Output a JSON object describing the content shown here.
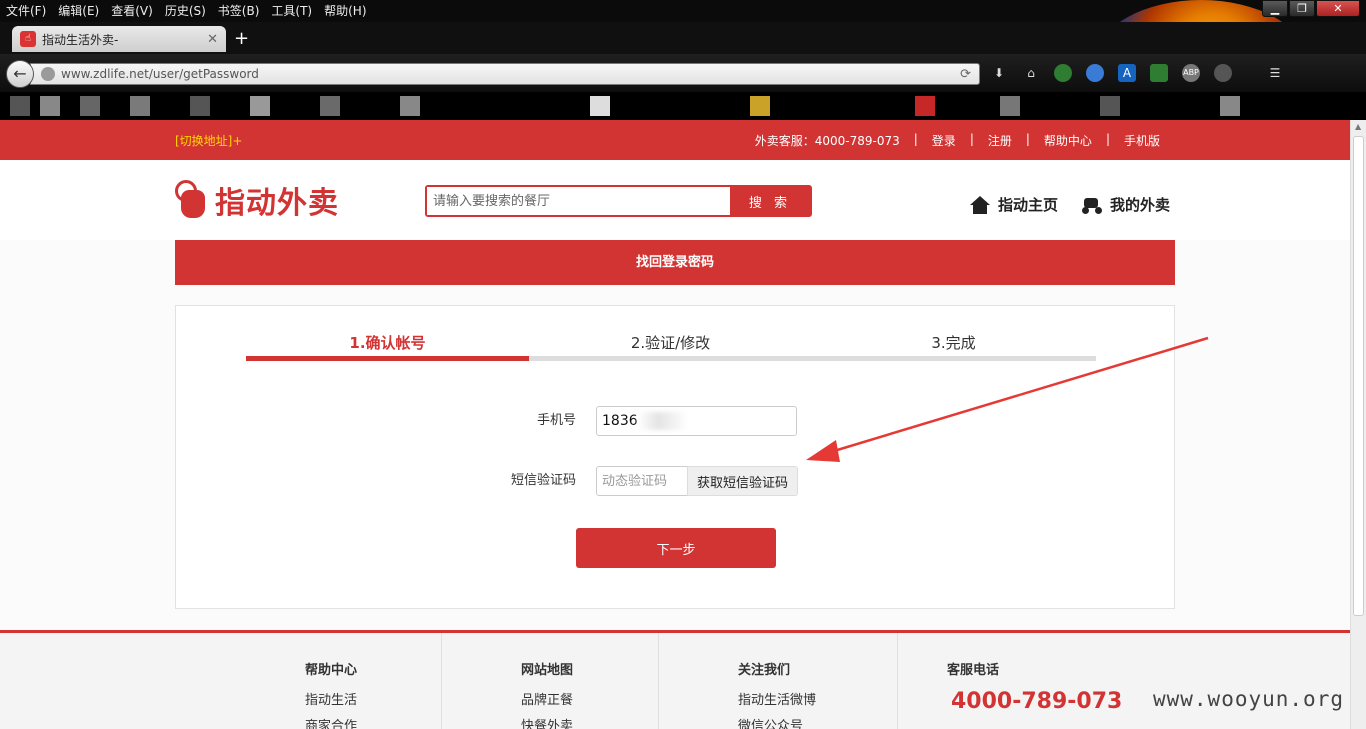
{
  "browser": {
    "menu": [
      "文件(F)",
      "编辑(E)",
      "查看(V)",
      "历史(S)",
      "书签(B)",
      "工具(T)",
      "帮助(H)"
    ],
    "tab_title": "指动生活外卖-",
    "url": "www.zdlife.net/user/getPassword"
  },
  "topbar": {
    "switch_address": "[切换地址]+",
    "hotline_label": "外卖客服：4000-789-073",
    "links": [
      "登录",
      "注册",
      "帮助中心",
      "手机版"
    ],
    "separator": "|"
  },
  "header": {
    "logo_text": "指动外卖",
    "search_placeholder": "请输入要搜索的餐厅",
    "search_button": "搜 索",
    "home_link": "指动主页",
    "orders_link": "我的外卖"
  },
  "page_title": "找回登录密码",
  "steps": [
    {
      "label": "1.确认帐号",
      "active": true
    },
    {
      "label": "2.验证/修改",
      "active": false
    },
    {
      "label": "3.完成",
      "active": false
    }
  ],
  "progress_fraction": 0.333,
  "form": {
    "phone_label": "手机号",
    "phone_value": "1836",
    "sms_label": "短信验证码",
    "sms_placeholder": "动态验证码",
    "sms_button": "获取短信验证码",
    "next_button": "下一步"
  },
  "footer": {
    "help": {
      "title": "帮助中心",
      "links": [
        "指动生活",
        "商家合作"
      ]
    },
    "sitemap": {
      "title": "网站地图",
      "links": [
        "品牌正餐",
        "快餐外卖"
      ]
    },
    "follow": {
      "title": "关注我们",
      "links": [
        "指动生活微博",
        "微信公众号"
      ]
    },
    "service": {
      "title": "客服电话",
      "phone": "4000-789-073"
    }
  },
  "watermark": "www.wooyun.org",
  "colors": {
    "brand_red": "#d23434",
    "gold": "#ffd700"
  }
}
